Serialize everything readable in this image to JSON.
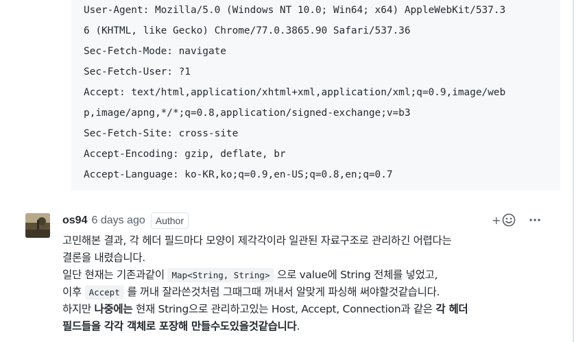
{
  "code_lines": [
    "User-Agent: Mozilla/5.0 (Windows NT 10.0; Win64; x64) AppleWebKit/537.3",
    "6 (KHTML, like Gecko) Chrome/77.0.3865.90 Safari/537.36",
    "Sec-Fetch-Mode: navigate",
    "Sec-Fetch-User: ?1",
    "Accept: text/html,application/xhtml+xml,application/xml;q=0.9,image/web",
    "p,image/apng,*/*;q=0.8,application/signed-exchange;v=b3",
    "Sec-Fetch-Site: cross-site",
    "Accept-Encoding: gzip, deflate, br",
    "Accept-Language: ko-KR,ko;q=0.9,en-US;q=0.8,en;q=0.7"
  ],
  "comment": {
    "author": "os94",
    "timestamp": "6 days ago",
    "badge": "Author",
    "reaction_plus": "+",
    "body": {
      "line1": "고민해본 결과, 각 헤더 필드마다 모양이 제각각이라 일관된 자료구조로 관리하긴 어렵다는",
      "line2": "결론을 내렸습니다.",
      "line3_pre": "일단 현재는 기존과같이 ",
      "line3_code": "Map<String, String>",
      "line3_post": " 으로 value에 String 전체를 넣었고,",
      "line4_pre": "이후 ",
      "line4_code": "Accept",
      "line4_post": " 를 꺼내 잘라쓴것처럼 그때그때 꺼내서 알맞게 파싱해 써야할것같습니다.",
      "line5_pre": "하지만 ",
      "line5_bold": "나중에는",
      "line5_mid": " 현재 String으로 관리하고있는 Host, Accept, Connection과 같은 ",
      "line5_bold2": "각 헤더",
      "line6_bold": "필드들을 각각 객체로 포장해 만들수도있을것같습니다",
      "line6_end": "."
    }
  },
  "colors": {
    "code_bg": "#f6f8fa",
    "text": "#24292e",
    "muted": "#586069",
    "border": "#e1e4e8"
  },
  "icons": [
    "smiley-icon",
    "kebab-icon",
    "avatar-image"
  ]
}
